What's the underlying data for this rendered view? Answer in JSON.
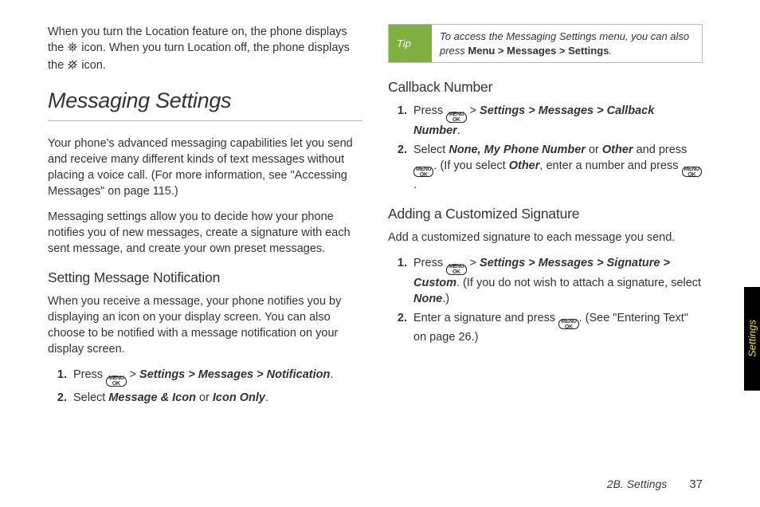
{
  "left": {
    "intro": {
      "t1": "When you turn the Location feature on, the phone displays the ",
      "t2": " icon. When you turn Location off, the phone displays the ",
      "t3": " icon."
    },
    "section_title": "Messaging Settings",
    "para1": "Your phone's advanced messaging capabilities let you send and receive many different kinds of text messages without placing a voice call. (For more information, see \"Accessing Messages\" on page 115.)",
    "para2": "Messaging settings allow you to decide how your phone notifies you of new messages, create a signature with each sent message, and create your own preset messages.",
    "sub1": "Setting Message Notification",
    "sub1_body": "When you receive a message, your phone notifies you by displaying an icon on your display screen. You can also choose to be notified with a message notification on your display screen.",
    "step1_a": "Press ",
    "step1_b": " > ",
    "step1_path": "Settings > Messages > Notification",
    "step1_c": ".",
    "step2_a": "Select ",
    "step2_b": "Message & Icon",
    "step2_c": " or ",
    "step2_d": "Icon Only",
    "step2_e": "."
  },
  "right": {
    "tip_label": "Tip",
    "tip_a": "To access the Messaging Settings menu, you can also press ",
    "tip_b": "Menu > Messages > Settings",
    "tip_c": ".",
    "sub_cb": "Callback Number",
    "cb1_a": "Press ",
    "cb1_b": " > ",
    "cb1_path": "Settings > Messages > Callback Number",
    "cb1_c": ".",
    "cb2_a": "Select ",
    "cb2_b": "None, My Phone Number",
    "cb2_c": " or ",
    "cb2_d": "Other",
    "cb2_e": " and press ",
    "cb2_f": ". (If you select ",
    "cb2_g": "Other",
    "cb2_h": ", enter a number and press ",
    "cb2_i": ".",
    "sub_sig": "Adding a Customized Signature",
    "sig_intro": "Add a customized signature to each message you send.",
    "sig1_a": "Press ",
    "sig1_b": " > ",
    "sig1_path": "Settings > Messages > Signature > Custom",
    "sig1_c": ". (If you do not wish to attach a signature, select ",
    "sig1_d": "None",
    "sig1_e": ".)",
    "sig2_a": "Enter a signature and press ",
    "sig2_b": ". (See \"Entering Text\" on page 26.)"
  },
  "key_label": "MENU\nOK",
  "side_tab": "Settings",
  "footer_section": "2B. Settings",
  "footer_page": "37",
  "icons": {
    "location_on": "location-on-icon",
    "location_off": "location-off-icon"
  }
}
